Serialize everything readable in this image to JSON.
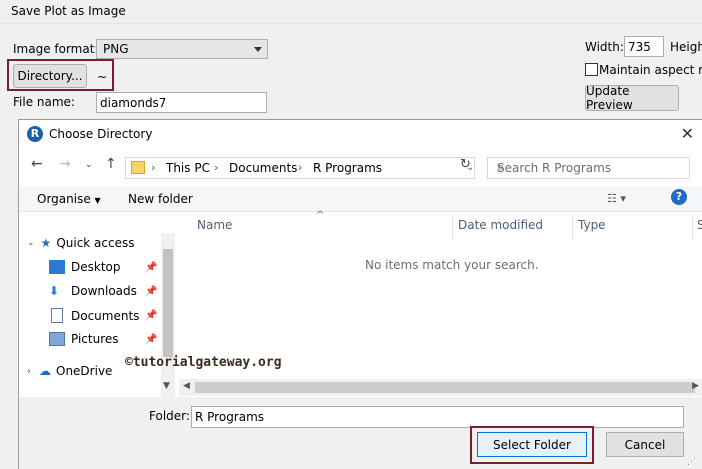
{
  "outer": {
    "title": "Save Plot as Image",
    "image_format_label": "Image format:",
    "image_format_value": "PNG",
    "directory_button": "Directory...",
    "directory_path": "~",
    "file_name_label": "File name:",
    "file_name_value": "diamonds7",
    "width_label": "Width:",
    "width_value": "735",
    "height_label": "Heigh",
    "maintain_aspect_label": "Maintain aspect rati",
    "update_preview_button": "Update Preview"
  },
  "dialog": {
    "title": "Choose Directory",
    "breadcrumb": [
      "This PC",
      "Documents",
      "R Programs"
    ],
    "search_placeholder": "Search R Programs",
    "organise_label": "Organise",
    "new_folder_label": "New folder",
    "nav_items": {
      "quick_access": "Quick access",
      "desktop": "Desktop",
      "downloads": "Downloads",
      "documents": "Documents",
      "pictures": "Pictures",
      "onedrive": "OneDrive"
    },
    "columns": {
      "name": "Name",
      "date": "Date modified",
      "type": "Type",
      "size": "S"
    },
    "empty_message": "No items match your search.",
    "folder_label": "Folder:",
    "folder_value": "R Programs",
    "select_button": "Select Folder",
    "cancel_button": "Cancel"
  },
  "watermark": "©tutorialgateway.org",
  "colors": {
    "highlight_border": "#7a1f2b",
    "accent": "#1c6bc6"
  }
}
